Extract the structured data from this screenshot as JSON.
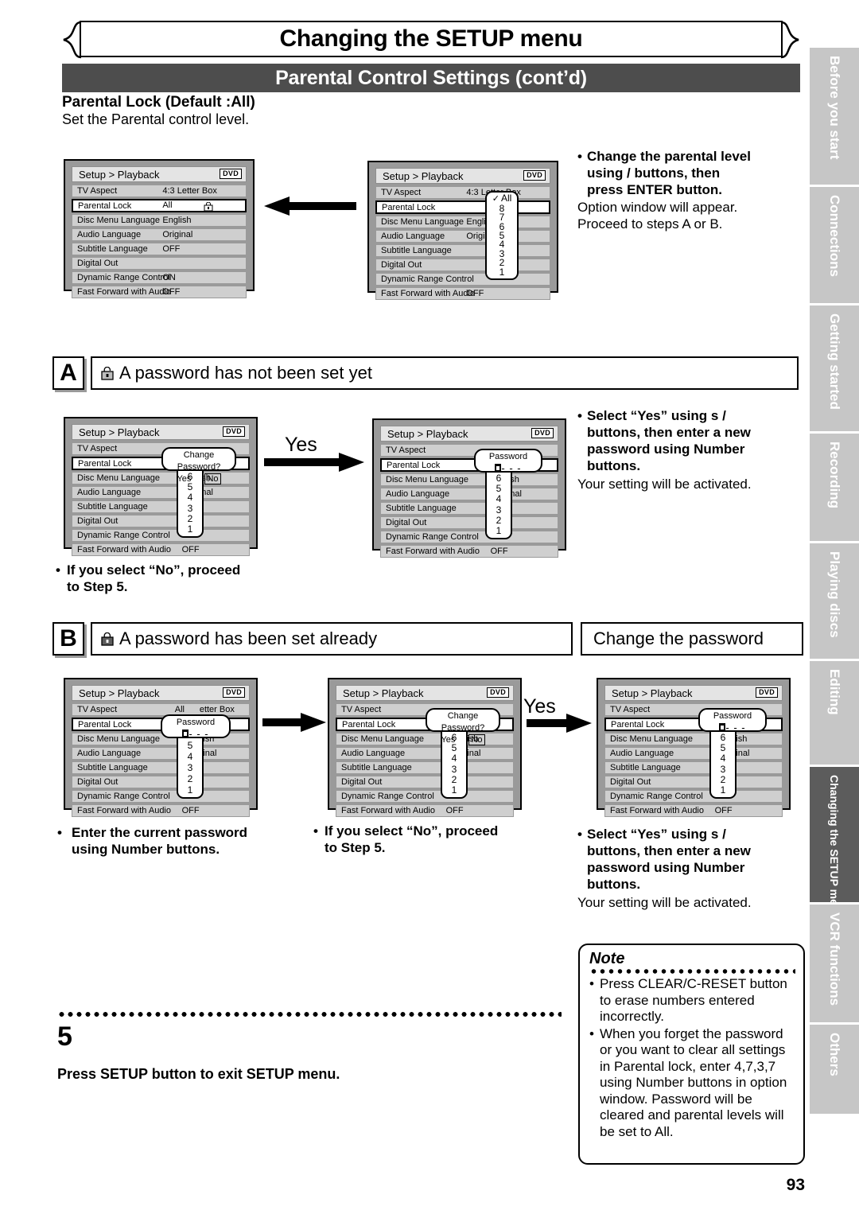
{
  "header": {
    "title": "Changing the SETUP menu",
    "section_bar": "Parental Control Settings (cont’d)",
    "sub_heading": "Parental Lock (Default :All)",
    "sub_description": "Set the Parental control level."
  },
  "menu_screen": {
    "breadcrumb": "Setup > Playback",
    "disc_badge": "DVD",
    "rows": [
      {
        "label": "TV Aspect",
        "value": "4:3 Letter Box"
      },
      {
        "label": "Parental Lock",
        "value": "All"
      },
      {
        "label": "Disc Menu Language",
        "value": "English"
      },
      {
        "label": "Audio Language",
        "value": "Original"
      },
      {
        "label": "Subtitle Language",
        "value": "OFF"
      },
      {
        "label": "Digital Out",
        "value": ""
      },
      {
        "label": "Dynamic Range Control",
        "value": "ON"
      },
      {
        "label": "Fast Forward with Audio",
        "value": "OFF"
      }
    ]
  },
  "option_window": {
    "checked": "All",
    "levels": [
      "8",
      "7",
      "6",
      "5",
      "4",
      "3",
      "2",
      "1"
    ],
    "levels_short": [
      "7",
      "6",
      "5",
      "4",
      "3",
      "2",
      "1"
    ],
    "levels_b": [
      "6",
      "5",
      "4",
      "3",
      "2",
      "1"
    ]
  },
  "dialogs": {
    "change_password_title": "Change Password?",
    "yes_label": "Yes",
    "no_label": "No",
    "password_title": "Password",
    "password_dots": "- - -"
  },
  "step_intro": {
    "bullet_bold_line1": "Change the parental level",
    "bullet_bold_line2": "using    /    buttons, then",
    "bullet_bold_line3": "press ENTER button.",
    "plain_line1": "Option window will appear.",
    "plain_line2": "Proceed to steps A or B."
  },
  "section_a": {
    "letter": "A",
    "heading": "A password has not been set yet",
    "arrow_label": "Yes",
    "bullet_bold": "Select “Yes” using s  / buttons, then enter a new password using Number buttons.",
    "bullet_bold_lines": [
      "Select “Yes” using s   /",
      "buttons, then enter a new",
      "password using Number",
      "buttons."
    ],
    "plain_line": "Your setting will be activated.",
    "no_note_lines": [
      "If you select “No”, proceed",
      "to Step 5."
    ]
  },
  "section_b": {
    "letter": "B",
    "heading": "A password has been set already",
    "heading_right": "Change the password",
    "arrow_label": "Yes",
    "note_enter_lines": [
      "Enter the current password",
      "using Number buttons."
    ],
    "note_no_lines": [
      "If you select “No”, proceed",
      "to Step 5."
    ],
    "note_yes_lines": [
      "Select “Yes” using s   /",
      "buttons, then enter a new",
      "password using Number",
      "buttons."
    ],
    "note_yes_plain": "Your setting will be activated."
  },
  "step5": {
    "number": "5",
    "text": "Press SETUP button to exit SETUP menu."
  },
  "note": {
    "title": "Note",
    "items": [
      "Press CLEAR/C-RESET button to erase numbers entered incorrectly.",
      "When you forget the password or you want to clear all settings in Parental lock, enter 4,7,3,7 using Number buttons in option window. Password will be cleared and parental levels will be set to All."
    ]
  },
  "side_tabs": [
    {
      "label": "Before you start",
      "active": false
    },
    {
      "label": "Connections",
      "active": false
    },
    {
      "label": "Getting started",
      "active": false
    },
    {
      "label": "Recording",
      "active": false
    },
    {
      "label": "Playing discs",
      "active": false
    },
    {
      "label": "Editing",
      "active": false
    },
    {
      "label": "Changing the SETUP menu",
      "active": true
    },
    {
      "label": "VCR functions",
      "active": false
    },
    {
      "label": "Others",
      "active": false
    }
  ],
  "page_number": "93",
  "colors": {
    "bar": "#4d4d4d",
    "tab_inactive": "#c6c6c6",
    "tab_active": "#5c5c5c",
    "screen_bg": "#9a9a9a",
    "row_bg": "#cfcfcf"
  }
}
